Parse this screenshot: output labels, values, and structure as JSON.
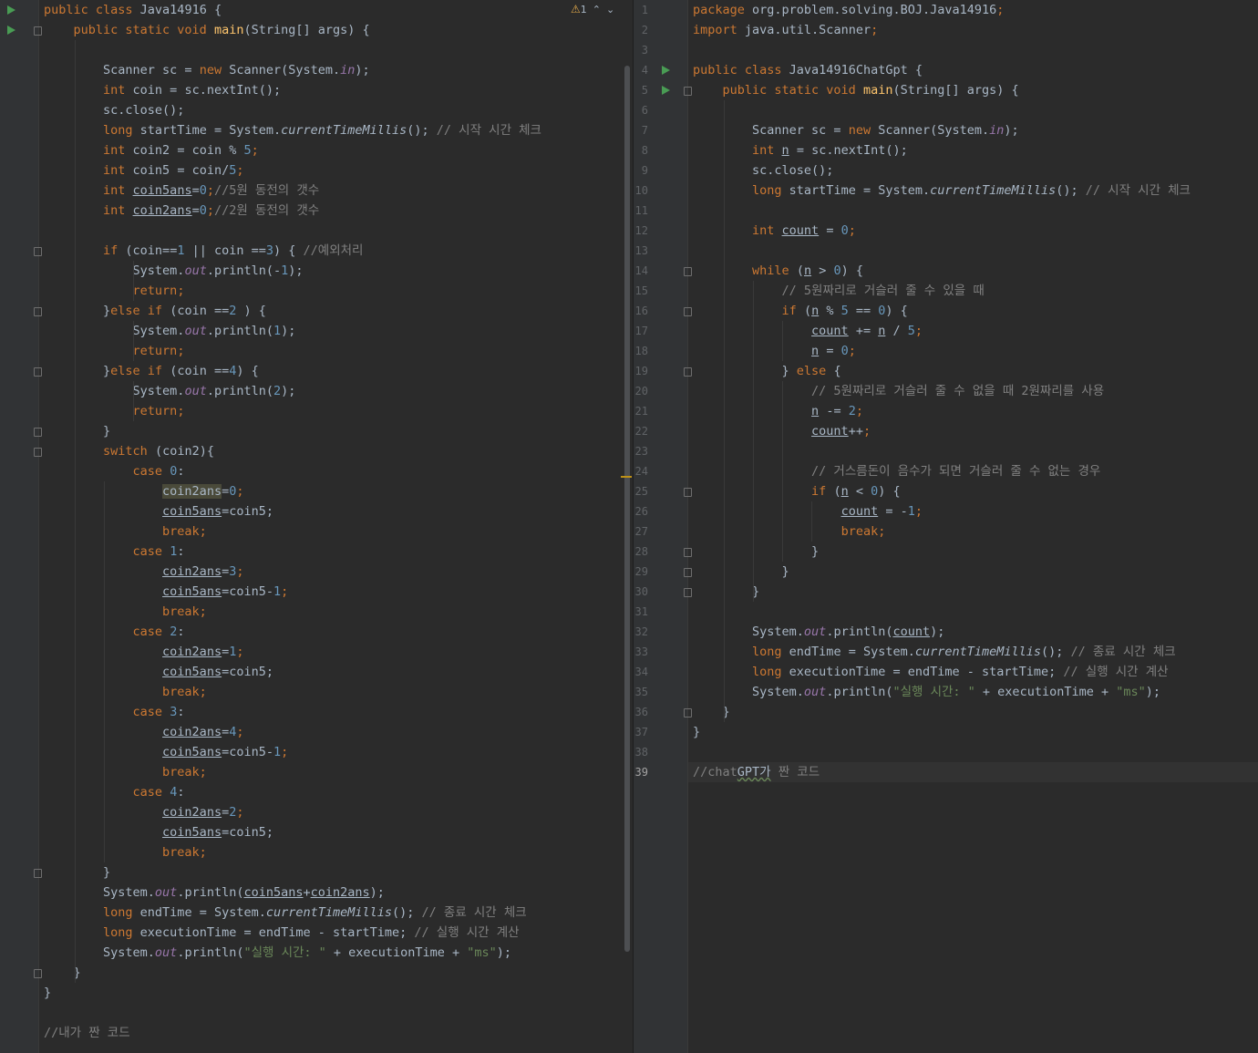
{
  "inspection": {
    "warning_count": "1",
    "up_label": "⌃",
    "down_label": "⌄"
  },
  "left_editor": {
    "lines": [
      [
        [
          "k",
          "public class "
        ],
        [
          "t",
          "Java14916 {"
        ]
      ],
      [
        [
          "t",
          "    "
        ],
        [
          "k",
          "public static void "
        ],
        [
          "fn",
          "main"
        ],
        [
          "t",
          "(String[] args) {"
        ]
      ],
      [],
      [
        [
          "t",
          "        Scanner sc = "
        ],
        [
          "k",
          "new "
        ],
        [
          "t",
          "Scanner(System."
        ],
        [
          "st",
          "in"
        ],
        [
          "t",
          ");"
        ]
      ],
      [
        [
          "t",
          "        "
        ],
        [
          "k",
          "int "
        ],
        [
          "t",
          "coin = sc.nextInt();"
        ]
      ],
      [
        [
          "t",
          "        sc.close();"
        ]
      ],
      [
        [
          "t",
          "        "
        ],
        [
          "k",
          "long "
        ],
        [
          "t",
          "startTime = System."
        ],
        [
          "it",
          "currentTimeMillis"
        ],
        [
          "t",
          "(); "
        ],
        [
          "cm",
          "// 시작 시간 체크"
        ]
      ],
      [
        [
          "t",
          "        "
        ],
        [
          "k",
          "int "
        ],
        [
          "t",
          "coin2 = coin % "
        ],
        [
          "num",
          "5"
        ],
        [
          "k",
          ";"
        ]
      ],
      [
        [
          "t",
          "        "
        ],
        [
          "k",
          "int "
        ],
        [
          "t",
          "coin5 = coin/"
        ],
        [
          "num",
          "5"
        ],
        [
          "k",
          ";"
        ]
      ],
      [
        [
          "t",
          "        "
        ],
        [
          "k",
          "int "
        ],
        [
          "u",
          "coin5ans"
        ],
        [
          "t",
          "="
        ],
        [
          "num",
          "0"
        ],
        [
          "k",
          ";"
        ],
        [
          "cm",
          "//5원 동전의 갯수"
        ]
      ],
      [
        [
          "t",
          "        "
        ],
        [
          "k",
          "int "
        ],
        [
          "u",
          "coin2ans"
        ],
        [
          "t",
          "="
        ],
        [
          "num",
          "0"
        ],
        [
          "k",
          ";"
        ],
        [
          "cm",
          "//2원 동전의 갯수"
        ]
      ],
      [],
      [
        [
          "t",
          "        "
        ],
        [
          "k",
          "if "
        ],
        [
          "t",
          "(coin=="
        ],
        [
          "num",
          "1"
        ],
        [
          "t",
          " || coin =="
        ],
        [
          "num",
          "3"
        ],
        [
          "t",
          ") { "
        ],
        [
          "cm",
          "//예외처리"
        ]
      ],
      [
        [
          "t",
          "            System."
        ],
        [
          "st",
          "out"
        ],
        [
          "t",
          ".println(-"
        ],
        [
          "num",
          "1"
        ],
        [
          "t",
          ");"
        ]
      ],
      [
        [
          "t",
          "            "
        ],
        [
          "k",
          "return;"
        ]
      ],
      [
        [
          "t",
          "        }"
        ],
        [
          "k",
          "else if "
        ],
        [
          "t",
          "(coin =="
        ],
        [
          "num",
          "2"
        ],
        [
          "t",
          " ) {"
        ]
      ],
      [
        [
          "t",
          "            System."
        ],
        [
          "st",
          "out"
        ],
        [
          "t",
          ".println("
        ],
        [
          "num",
          "1"
        ],
        [
          "t",
          ");"
        ]
      ],
      [
        [
          "t",
          "            "
        ],
        [
          "k",
          "return;"
        ]
      ],
      [
        [
          "t",
          "        }"
        ],
        [
          "k",
          "else if "
        ],
        [
          "t",
          "(coin =="
        ],
        [
          "num",
          "4"
        ],
        [
          "t",
          ") {"
        ]
      ],
      [
        [
          "t",
          "            System."
        ],
        [
          "st",
          "out"
        ],
        [
          "t",
          ".println("
        ],
        [
          "num",
          "2"
        ],
        [
          "t",
          ");"
        ]
      ],
      [
        [
          "t",
          "            "
        ],
        [
          "k",
          "return;"
        ]
      ],
      [
        [
          "t",
          "        }"
        ]
      ],
      [
        [
          "t",
          "        "
        ],
        [
          "k",
          "switch "
        ],
        [
          "t",
          "(coin2){"
        ]
      ],
      [
        [
          "t",
          "            "
        ],
        [
          "k",
          "case "
        ],
        [
          "num",
          "0"
        ],
        [
          "t",
          ":"
        ]
      ],
      [
        [
          "t",
          "                "
        ],
        [
          "hl",
          "coin2ans"
        ],
        [
          "t",
          "="
        ],
        [
          "num",
          "0"
        ],
        [
          "k",
          ";"
        ]
      ],
      [
        [
          "t",
          "                "
        ],
        [
          "u",
          "coin5ans"
        ],
        [
          "t",
          "=coin5;"
        ]
      ],
      [
        [
          "t",
          "                "
        ],
        [
          "k",
          "break;"
        ]
      ],
      [
        [
          "t",
          "            "
        ],
        [
          "k",
          "case "
        ],
        [
          "num",
          "1"
        ],
        [
          "t",
          ":"
        ]
      ],
      [
        [
          "t",
          "                "
        ],
        [
          "u",
          "coin2ans"
        ],
        [
          "t",
          "="
        ],
        [
          "num",
          "3"
        ],
        [
          "k",
          ";"
        ]
      ],
      [
        [
          "t",
          "                "
        ],
        [
          "u",
          "coin5ans"
        ],
        [
          "t",
          "=coin5-"
        ],
        [
          "num",
          "1"
        ],
        [
          "k",
          ";"
        ]
      ],
      [
        [
          "t",
          "                "
        ],
        [
          "k",
          "break;"
        ]
      ],
      [
        [
          "t",
          "            "
        ],
        [
          "k",
          "case "
        ],
        [
          "num",
          "2"
        ],
        [
          "t",
          ":"
        ]
      ],
      [
        [
          "t",
          "                "
        ],
        [
          "u",
          "coin2ans"
        ],
        [
          "t",
          "="
        ],
        [
          "num",
          "1"
        ],
        [
          "k",
          ";"
        ]
      ],
      [
        [
          "t",
          "                "
        ],
        [
          "u",
          "coin5ans"
        ],
        [
          "t",
          "=coin5;"
        ]
      ],
      [
        [
          "t",
          "                "
        ],
        [
          "k",
          "break;"
        ]
      ],
      [
        [
          "t",
          "            "
        ],
        [
          "k",
          "case "
        ],
        [
          "num",
          "3"
        ],
        [
          "t",
          ":"
        ]
      ],
      [
        [
          "t",
          "                "
        ],
        [
          "u",
          "coin2ans"
        ],
        [
          "t",
          "="
        ],
        [
          "num",
          "4"
        ],
        [
          "k",
          ";"
        ]
      ],
      [
        [
          "t",
          "                "
        ],
        [
          "u",
          "coin5ans"
        ],
        [
          "t",
          "=coin5-"
        ],
        [
          "num",
          "1"
        ],
        [
          "k",
          ";"
        ]
      ],
      [
        [
          "t",
          "                "
        ],
        [
          "k",
          "break;"
        ]
      ],
      [
        [
          "t",
          "            "
        ],
        [
          "k",
          "case "
        ],
        [
          "num",
          "4"
        ],
        [
          "t",
          ":"
        ]
      ],
      [
        [
          "t",
          "                "
        ],
        [
          "u",
          "coin2ans"
        ],
        [
          "t",
          "="
        ],
        [
          "num",
          "2"
        ],
        [
          "k",
          ";"
        ]
      ],
      [
        [
          "t",
          "                "
        ],
        [
          "u",
          "coin5ans"
        ],
        [
          "t",
          "=coin5;"
        ]
      ],
      [
        [
          "t",
          "                "
        ],
        [
          "k",
          "break;"
        ]
      ],
      [
        [
          "t",
          "        }"
        ]
      ],
      [
        [
          "t",
          "        System."
        ],
        [
          "st",
          "out"
        ],
        [
          "t",
          ".println("
        ],
        [
          "u",
          "coin5ans"
        ],
        [
          "t",
          "+"
        ],
        [
          "u",
          "coin2ans"
        ],
        [
          "t",
          ");"
        ]
      ],
      [
        [
          "t",
          "        "
        ],
        [
          "k",
          "long "
        ],
        [
          "t",
          "endTime = System."
        ],
        [
          "it",
          "currentTimeMillis"
        ],
        [
          "t",
          "(); "
        ],
        [
          "cm",
          "// 종료 시간 체크"
        ]
      ],
      [
        [
          "t",
          "        "
        ],
        [
          "k",
          "long "
        ],
        [
          "t",
          "executionTime = endTime - startTime; "
        ],
        [
          "cm",
          "// 실행 시간 계산"
        ]
      ],
      [
        [
          "t",
          "        System."
        ],
        [
          "st",
          "out"
        ],
        [
          "t",
          ".println("
        ],
        [
          "str",
          "\"실행 시간: \""
        ],
        [
          "t",
          " + executionTime + "
        ],
        [
          "str",
          "\"ms\""
        ],
        [
          "t",
          ");"
        ]
      ],
      [
        [
          "t",
          "    }"
        ]
      ],
      [
        [
          "t",
          "}"
        ]
      ],
      [],
      [
        [
          "cm",
          "//내가 짠 코드"
        ]
      ]
    ]
  },
  "right_editor": {
    "line_numbers": [
      "1",
      "2",
      "3",
      "4",
      "5",
      "6",
      "7",
      "8",
      "9",
      "10",
      "11",
      "12",
      "13",
      "14",
      "15",
      "16",
      "17",
      "18",
      "19",
      "20",
      "21",
      "22",
      "23",
      "24",
      "25",
      "26",
      "27",
      "28",
      "29",
      "30",
      "31",
      "32",
      "33",
      "34",
      "35",
      "36",
      "37",
      "38",
      "39"
    ],
    "current_line": "39",
    "lines": [
      [
        [
          "k",
          "package "
        ],
        [
          "t",
          "org.problem.solving.BOJ.Java14916"
        ],
        [
          "k",
          ";"
        ]
      ],
      [
        [
          "k",
          "import "
        ],
        [
          "t",
          "java.util.Scanner"
        ],
        [
          "k",
          ";"
        ]
      ],
      [],
      [
        [
          "k",
          "public class "
        ],
        [
          "t",
          "Java14916ChatGpt {"
        ]
      ],
      [
        [
          "t",
          "    "
        ],
        [
          "k",
          "public static void "
        ],
        [
          "fn",
          "main"
        ],
        [
          "t",
          "(String[] args) {"
        ]
      ],
      [],
      [
        [
          "t",
          "        Scanner sc = "
        ],
        [
          "k",
          "new "
        ],
        [
          "t",
          "Scanner(System."
        ],
        [
          "st",
          "in"
        ],
        [
          "t",
          ");"
        ]
      ],
      [
        [
          "t",
          "        "
        ],
        [
          "k",
          "int "
        ],
        [
          "u",
          "n"
        ],
        [
          "t",
          " = sc.nextInt();"
        ]
      ],
      [
        [
          "t",
          "        sc.close();"
        ]
      ],
      [
        [
          "t",
          "        "
        ],
        [
          "k",
          "long "
        ],
        [
          "t",
          "startTime = System."
        ],
        [
          "it",
          "currentTimeMillis"
        ],
        [
          "t",
          "(); "
        ],
        [
          "cm",
          "// 시작 시간 체크"
        ]
      ],
      [],
      [
        [
          "t",
          "        "
        ],
        [
          "k",
          "int "
        ],
        [
          "u",
          "count"
        ],
        [
          "t",
          " = "
        ],
        [
          "num",
          "0"
        ],
        [
          "k",
          ";"
        ]
      ],
      [],
      [
        [
          "t",
          "        "
        ],
        [
          "k",
          "while "
        ],
        [
          "t",
          "("
        ],
        [
          "u",
          "n"
        ],
        [
          "t",
          " > "
        ],
        [
          "num",
          "0"
        ],
        [
          "t",
          ") {"
        ]
      ],
      [
        [
          "t",
          "            "
        ],
        [
          "cm",
          "// 5원짜리로 거슬러 줄 수 있을 때"
        ]
      ],
      [
        [
          "t",
          "            "
        ],
        [
          "k",
          "if "
        ],
        [
          "t",
          "("
        ],
        [
          "u",
          "n"
        ],
        [
          "t",
          " % "
        ],
        [
          "num",
          "5"
        ],
        [
          "t",
          " == "
        ],
        [
          "num",
          "0"
        ],
        [
          "t",
          ") {"
        ]
      ],
      [
        [
          "t",
          "                "
        ],
        [
          "u",
          "count"
        ],
        [
          "t",
          " += "
        ],
        [
          "u",
          "n"
        ],
        [
          "t",
          " / "
        ],
        [
          "num",
          "5"
        ],
        [
          "k",
          ";"
        ]
      ],
      [
        [
          "t",
          "                "
        ],
        [
          "u",
          "n"
        ],
        [
          "t",
          " = "
        ],
        [
          "num",
          "0"
        ],
        [
          "k",
          ";"
        ]
      ],
      [
        [
          "t",
          "            } "
        ],
        [
          "k",
          "else "
        ],
        [
          "t",
          "{"
        ]
      ],
      [
        [
          "t",
          "                "
        ],
        [
          "cm",
          "// 5원짜리로 거슬러 줄 수 없을 때 2원짜리를 사용"
        ]
      ],
      [
        [
          "t",
          "                "
        ],
        [
          "u",
          "n"
        ],
        [
          "t",
          " -= "
        ],
        [
          "num",
          "2"
        ],
        [
          "k",
          ";"
        ]
      ],
      [
        [
          "t",
          "                "
        ],
        [
          "u",
          "count"
        ],
        [
          "t",
          "++"
        ],
        [
          "k",
          ";"
        ]
      ],
      [],
      [
        [
          "t",
          "                "
        ],
        [
          "cm",
          "// 거스름돈이 음수가 되면 거슬러 줄 수 없는 경우"
        ]
      ],
      [
        [
          "t",
          "                "
        ],
        [
          "k",
          "if "
        ],
        [
          "t",
          "("
        ],
        [
          "u",
          "n"
        ],
        [
          "t",
          " < "
        ],
        [
          "num",
          "0"
        ],
        [
          "t",
          ") {"
        ]
      ],
      [
        [
          "t",
          "                    "
        ],
        [
          "u",
          "count"
        ],
        [
          "t",
          " = -"
        ],
        [
          "num",
          "1"
        ],
        [
          "k",
          ";"
        ]
      ],
      [
        [
          "t",
          "                    "
        ],
        [
          "k",
          "break;"
        ]
      ],
      [
        [
          "t",
          "                }"
        ]
      ],
      [
        [
          "t",
          "            }"
        ]
      ],
      [
        [
          "t",
          "        }"
        ]
      ],
      [],
      [
        [
          "t",
          "        System."
        ],
        [
          "st",
          "out"
        ],
        [
          "t",
          ".println("
        ],
        [
          "u",
          "count"
        ],
        [
          "t",
          ");"
        ]
      ],
      [
        [
          "t",
          "        "
        ],
        [
          "k",
          "long "
        ],
        [
          "t",
          "endTime = System."
        ],
        [
          "it",
          "currentTimeMillis"
        ],
        [
          "t",
          "(); "
        ],
        [
          "cm",
          "// 종료 시간 체크"
        ]
      ],
      [
        [
          "t",
          "        "
        ],
        [
          "k",
          "long "
        ],
        [
          "t",
          "executionTime = endTime - startTime; "
        ],
        [
          "cm",
          "// 실행 시간 계산"
        ]
      ],
      [
        [
          "t",
          "        System."
        ],
        [
          "st",
          "out"
        ],
        [
          "t",
          ".println("
        ],
        [
          "str",
          "\"실행 시간: \""
        ],
        [
          "t",
          " + executionTime + "
        ],
        [
          "str",
          "\"ms\""
        ],
        [
          "t",
          ");"
        ]
      ],
      [
        [
          "t",
          "    }"
        ]
      ],
      [
        [
          "t",
          "}"
        ]
      ],
      [],
      [
        [
          "cm",
          "//chat"
        ],
        [
          "wav",
          "GPT가"
        ],
        [
          "cm",
          " 짠 코드"
        ]
      ]
    ]
  }
}
